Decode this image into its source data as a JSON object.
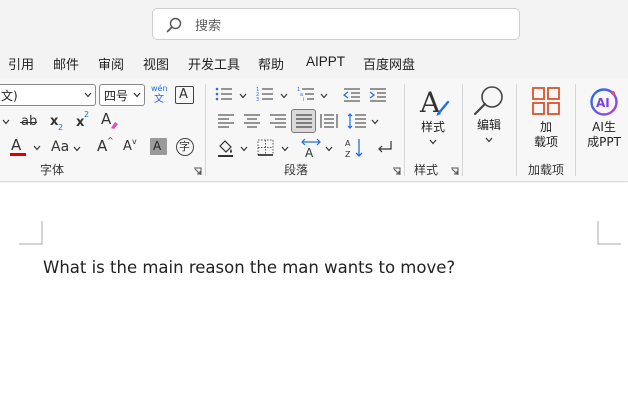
{
  "search": {
    "placeholder": "搜索"
  },
  "menu": [
    "引用",
    "邮件",
    "审阅",
    "视图",
    "开发工具",
    "帮助",
    "AIPPT",
    "百度网盘"
  ],
  "font": {
    "name_fragment": "文)",
    "size": "四号",
    "phonetic_top": "wén",
    "phonetic_bottom": "文",
    "group_label": "字体"
  },
  "paragraph": {
    "group_label": "段落"
  },
  "styles": {
    "button_label": "样式",
    "group_label": "样式"
  },
  "editing": {
    "button_label": "编辑"
  },
  "addins": {
    "line1": "加",
    "line2": "载项",
    "group_label": "加载项"
  },
  "aippt": {
    "line1": "AI生",
    "line2": "成PPT"
  },
  "document": {
    "text": "What is the main reason the man wants to move?"
  },
  "colors": {
    "font_color_bar": "#e00000",
    "addin_orange": "#d9532b",
    "ai_purple": "#7b3fe4",
    "ai_blue": "#1f6fe5",
    "selected_bg": "#dadada"
  }
}
